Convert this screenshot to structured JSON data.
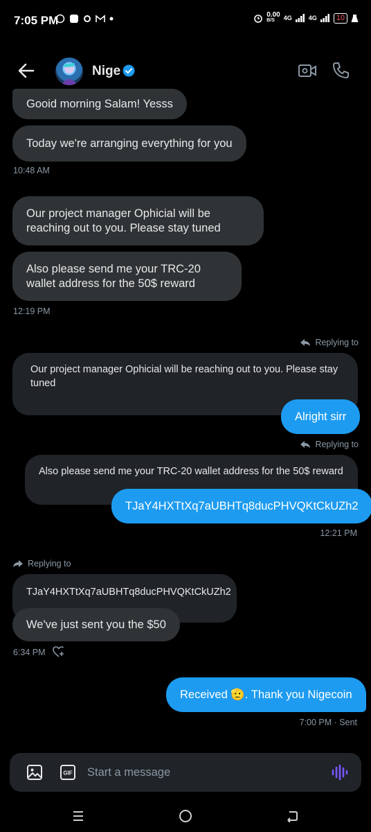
{
  "status_bar": {
    "time": "7:05 PM",
    "net_speed": "0.00",
    "net_unit": "B/S",
    "net_1": "4G",
    "net_2": "4G",
    "battery": "10"
  },
  "header": {
    "contact_name": "Nige"
  },
  "messages": [
    {
      "id": "m1",
      "direction": "incoming",
      "text": "Gooid morning Salam! Yesss"
    },
    {
      "id": "m2",
      "direction": "incoming",
      "text": "Today we're arranging everything for you"
    },
    {
      "id": "t1",
      "timestamp": "10:48 AM"
    },
    {
      "id": "m3",
      "direction": "incoming",
      "text": "Our project manager Ophicial will be reaching out to you. Please stay tuned"
    },
    {
      "id": "m4",
      "direction": "incoming",
      "text": "Also please send me your TRC-20 wallet address for the 50$ reward"
    },
    {
      "id": "t2",
      "timestamp": "12:19 PM"
    },
    {
      "id": "r1",
      "replying_label": "Replying to",
      "quoted": "Our project manager Ophicial will be reaching out to you. Please stay tuned",
      "direction": "outgoing",
      "text": "Alright sirr"
    },
    {
      "id": "r2",
      "replying_label": "Replying to",
      "quoted": "Also please send me your TRC-20 wallet address for the 50$ reward",
      "direction": "outgoing",
      "text": "TJaY4HXTtXq7aUBHTq8ducPHVQKtCkUZh2"
    },
    {
      "id": "t3",
      "timestamp": "12:21 PM"
    },
    {
      "id": "r3",
      "replying_label": "Replying to",
      "quoted": "TJaY4HXTtXq7aUBHTq8ducPHVQKtCkUZh2",
      "direction": "incoming",
      "text": "We've just sent you the $50"
    },
    {
      "id": "t4",
      "timestamp": "6:34 PM"
    },
    {
      "id": "m5",
      "direction": "outgoing",
      "text": "Received 🫡. Thank you Nigecoin"
    },
    {
      "id": "t5",
      "timestamp": "7:00 PM · Sent"
    }
  ],
  "composer": {
    "placeholder": "Start a message"
  },
  "colors": {
    "background": "#000000",
    "incoming_bubble": "#2f3336",
    "outgoing_bubble": "#1d9bf0",
    "quote_bg": "#202327",
    "muted_text": "#8b98a5",
    "verified": "#1d9bf0",
    "voice_accent": "#7856ff"
  },
  "icons": {
    "back": "arrow-left-icon",
    "verified": "verified-badge-icon",
    "video": "video-call-icon",
    "call": "phone-icon",
    "reply": "reply-arrow-icon",
    "react": "heart-plus-icon",
    "image": "image-icon",
    "gif": "gif-icon",
    "voice": "voice-wave-icon"
  }
}
